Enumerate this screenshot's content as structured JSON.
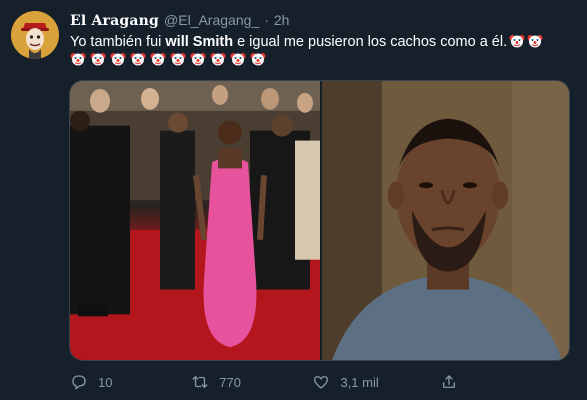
{
  "tweet": {
    "display_name": "El Aragang",
    "handle": "@El_Aragang_",
    "separator": "·",
    "time": "2h",
    "text_before": "Yo también fui ",
    "text_bold": "will Smith",
    "text_after": " e igual me pusieron los cachos como a él.",
    "emoji_count_inline": 2,
    "emoji_count_row": 10,
    "emoji_name": "clown-face"
  },
  "media": {
    "photos": [
      {
        "name": "photo-red-carpet"
      },
      {
        "name": "photo-portrait"
      }
    ]
  },
  "actions": {
    "reply_count": "10",
    "retweet_count": "770",
    "like_count": "3,1 mil",
    "share_label": ""
  },
  "icons": {
    "reply": "reply-icon",
    "retweet": "retweet-icon",
    "like": "heart-icon",
    "share": "share-icon"
  },
  "colors": {
    "background": "#15202b",
    "text_primary": "#ffffff",
    "text_secondary": "#8899a6",
    "border": "#38444d"
  }
}
